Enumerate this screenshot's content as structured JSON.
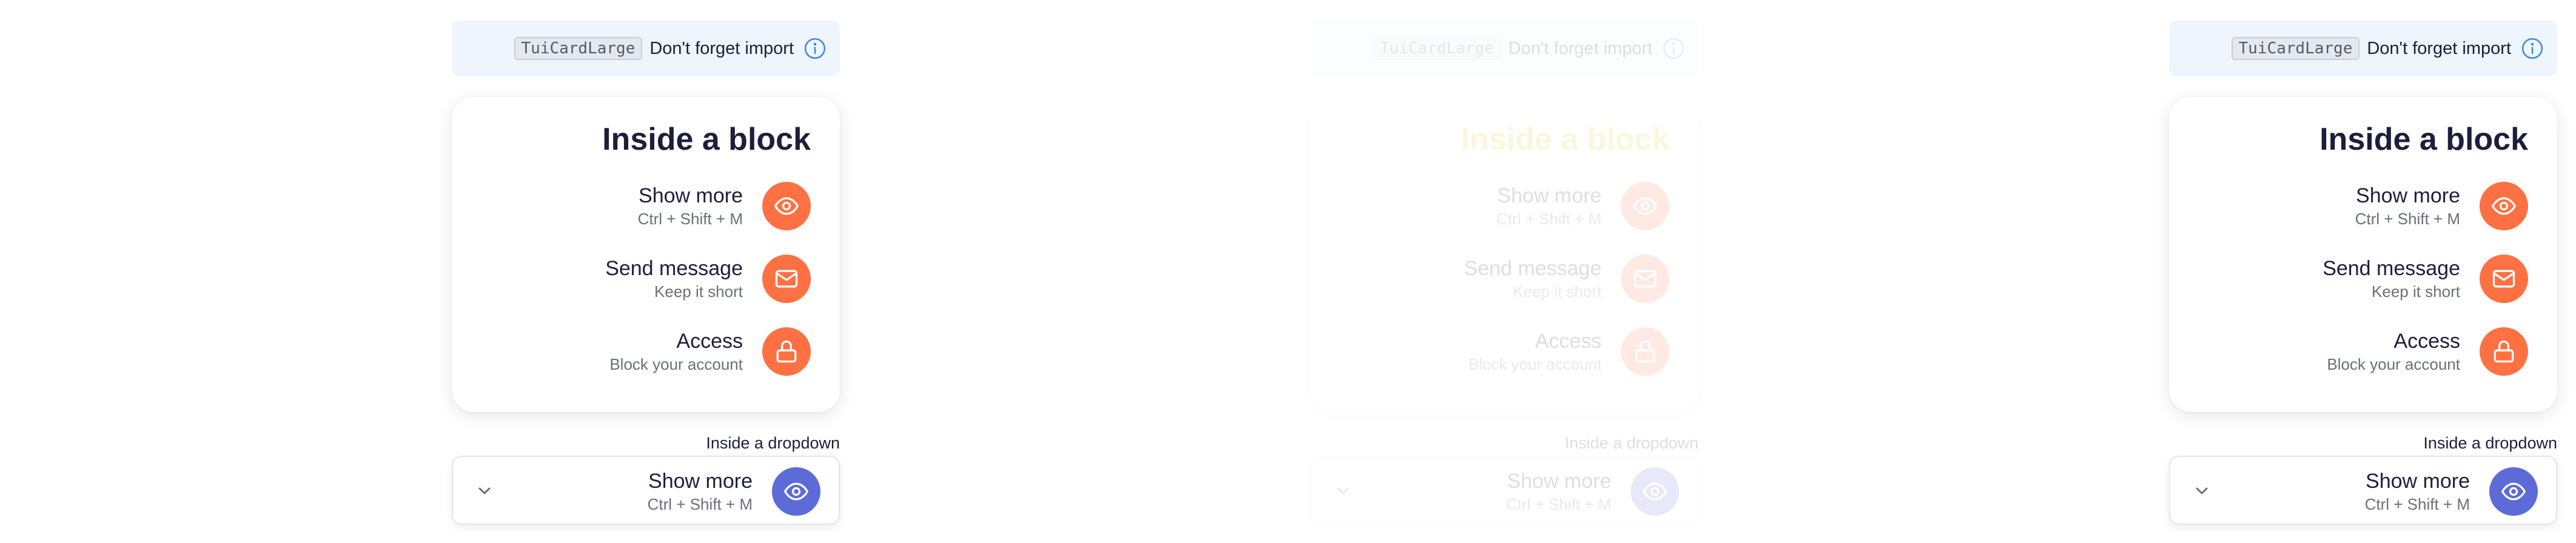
{
  "panels": [
    {
      "state": "normal",
      "note": {
        "code": "TuiCardLarge",
        "text": "Don't forget import",
        "icon": "info-icon"
      },
      "block": {
        "title": "Inside a block",
        "items": [
          {
            "label": "Show more",
            "subtitle": "Ctrl + Shift + M",
            "icon": "eye-icon"
          },
          {
            "label": "Send message",
            "subtitle": "Keep it short",
            "icon": "mail-icon"
          },
          {
            "label": "Access",
            "subtitle": "Block your account",
            "icon": "lock-icon"
          }
        ]
      },
      "dropdown": {
        "caption": "Inside a dropdown",
        "label": "Show more",
        "subtitle": "Ctrl + Shift + M",
        "icon": "eye-icon"
      }
    },
    {
      "state": "faded",
      "note": {
        "code": "TuiCardLarge",
        "text": "Don't forget import",
        "icon": "info-icon"
      },
      "block": {
        "title": "Inside a block",
        "items": [
          {
            "label": "Show more",
            "subtitle": "Ctrl + Shift + M",
            "icon": "eye-icon"
          },
          {
            "label": "Send message",
            "subtitle": "Keep it short",
            "icon": "mail-icon"
          },
          {
            "label": "Access",
            "subtitle": "Block your account",
            "icon": "lock-icon"
          }
        ]
      },
      "dropdown": {
        "caption": "Inside a dropdown",
        "label": "Show more",
        "subtitle": "Ctrl + Shift + M",
        "icon": "eye-icon"
      }
    },
    {
      "state": "normal",
      "note": {
        "code": "TuiCardLarge",
        "text": "Don't forget import",
        "icon": "info-icon"
      },
      "block": {
        "title": "Inside a block",
        "items": [
          {
            "label": "Show more",
            "subtitle": "Ctrl + Shift + M",
            "icon": "eye-icon"
          },
          {
            "label": "Send message",
            "subtitle": "Keep it short",
            "icon": "mail-icon"
          },
          {
            "label": "Access",
            "subtitle": "Block your account",
            "icon": "lock-icon"
          }
        ]
      },
      "dropdown": {
        "caption": "Inside a dropdown",
        "label": "Show more",
        "subtitle": "Ctrl + Shift + M",
        "icon": "eye-icon"
      }
    }
  ],
  "colors": {
    "accent": "#ff7043",
    "dropdown_accent": "#5c6bd6",
    "note_background": "#eef5fd",
    "info": "#3d8bd6",
    "faded_title_accent": "#e5c800"
  }
}
